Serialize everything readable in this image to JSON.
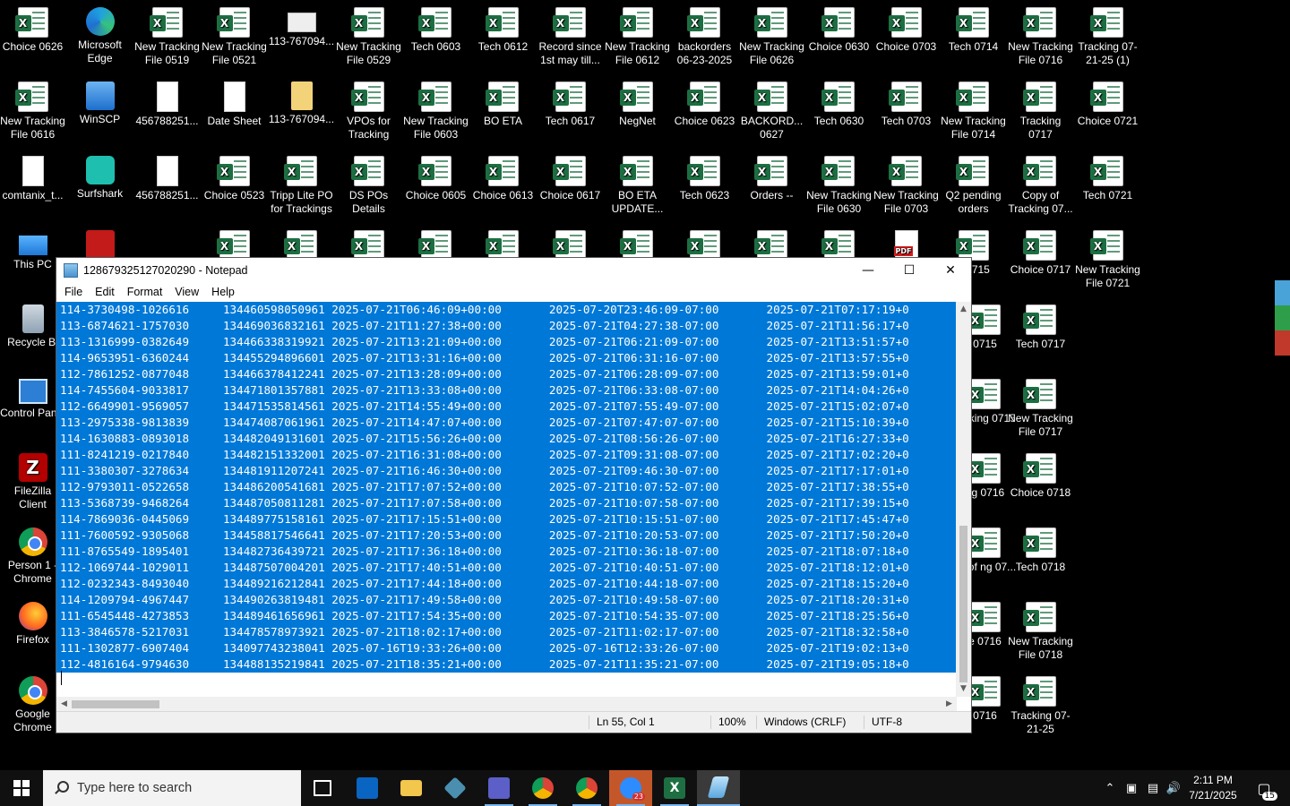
{
  "desktop": {
    "row1": [
      {
        "label": "Choice 0626",
        "icon": "excel-icon"
      },
      {
        "label": "Microsoft Edge",
        "icon": "edge-icon"
      },
      {
        "label": "New Tracking File 0519",
        "icon": "excel-icon"
      },
      {
        "label": "New Tracking File 0521",
        "icon": "excel-icon"
      },
      {
        "label": "113-767094...",
        "icon": "image-icon"
      },
      {
        "label": "New Tracking File 0529",
        "icon": "excel-icon"
      },
      {
        "label": "Tech 0603",
        "icon": "excel-icon"
      },
      {
        "label": "Tech 0612",
        "icon": "excel-icon"
      },
      {
        "label": "Record since 1st may till...",
        "icon": "excel-icon"
      },
      {
        "label": "New Tracking File 0612",
        "icon": "excel-icon"
      },
      {
        "label": "backorders 06-23-2025",
        "icon": "excel-icon"
      },
      {
        "label": "New Tracking File 0626",
        "icon": "excel-icon"
      },
      {
        "label": "Choice 0630",
        "icon": "excel-icon"
      },
      {
        "label": "Choice 0703",
        "icon": "excel-icon"
      },
      {
        "label": "Tech 0714",
        "icon": "excel-icon"
      },
      {
        "label": "New Tracking File 0716",
        "icon": "excel-icon"
      },
      {
        "label": "Tracking 07-21-25 (1)",
        "icon": "excel-icon"
      }
    ],
    "row2": [
      {
        "label": "New Tracking File 0616",
        "icon": "excel-icon"
      },
      {
        "label": "WinSCP",
        "icon": "winscp-icon"
      },
      {
        "label": "456788251...",
        "icon": "document-icon"
      },
      {
        "label": "Date Sheet",
        "icon": "document-icon"
      },
      {
        "label": "113-767094...",
        "icon": "folder-icon"
      },
      {
        "label": "VPOs for Tracking",
        "icon": "excel-icon"
      },
      {
        "label": "New Tracking File 0603",
        "icon": "excel-icon"
      },
      {
        "label": "BO ETA",
        "icon": "excel-icon"
      },
      {
        "label": "Tech 0617",
        "icon": "excel-icon"
      },
      {
        "label": "NegNet",
        "icon": "excel-icon"
      },
      {
        "label": "Choice 0623",
        "icon": "excel-icon"
      },
      {
        "label": "BACKORD... 0627",
        "icon": "excel-icon"
      },
      {
        "label": "Tech 0630",
        "icon": "excel-icon"
      },
      {
        "label": "Tech 0703",
        "icon": "excel-icon"
      },
      {
        "label": "New Tracking File 0714",
        "icon": "excel-icon"
      },
      {
        "label": "Tracking 0717",
        "icon": "excel-icon"
      },
      {
        "label": "Choice 0721",
        "icon": "excel-icon"
      }
    ],
    "row3": [
      {
        "label": "comtanix_t...",
        "icon": "document-icon"
      },
      {
        "label": "Surfshark",
        "icon": "surfshark-icon"
      },
      {
        "label": "456788251...",
        "icon": "document-icon"
      },
      {
        "label": "Choice 0523",
        "icon": "excel-icon"
      },
      {
        "label": "Tripp Lite PO for Trackings",
        "icon": "excel-icon"
      },
      {
        "label": "DS POs Details",
        "icon": "excel-icon"
      },
      {
        "label": "Choice 0605",
        "icon": "excel-icon"
      },
      {
        "label": "Choice 0613",
        "icon": "excel-icon"
      },
      {
        "label": "Choice 0617",
        "icon": "excel-icon"
      },
      {
        "label": "BO ETA UPDATE...",
        "icon": "excel-icon"
      },
      {
        "label": "Tech 0623",
        "icon": "excel-icon"
      },
      {
        "label": "Orders --",
        "icon": "excel-icon"
      },
      {
        "label": "New Tracking File 0630",
        "icon": "excel-icon"
      },
      {
        "label": "New Tracking File 0703",
        "icon": "excel-icon"
      },
      {
        "label": "Q2 pending orders",
        "icon": "excel-icon"
      },
      {
        "label": "Copy of Tracking 07...",
        "icon": "excel-icon"
      },
      {
        "label": "Tech 0721",
        "icon": "excel-icon"
      }
    ],
    "row4_right": [
      {
        "label": "e 0715",
        "icon": "excel-icon"
      },
      {
        "label": "Choice 0717",
        "icon": "excel-icon"
      },
      {
        "label": "New Tracking File 0721",
        "icon": "excel-icon"
      }
    ],
    "left_column": [
      {
        "label": "This PC",
        "icon": "this-pc-icon"
      },
      {
        "label": "Recycle Bi",
        "icon": "recycle-bin-icon"
      },
      {
        "label": "Control Panel",
        "icon": "control-panel-icon"
      },
      {
        "label": "FileZilla Client",
        "icon": "filezilla-icon"
      },
      {
        "label": "Person 1 - Chrome",
        "icon": "chrome-icon"
      },
      {
        "label": "Firefox",
        "icon": "firefox-icon"
      },
      {
        "label": "Google Chrome",
        "icon": "chrome-icon"
      }
    ],
    "right_col_a": [
      {
        "label": "0715",
        "icon": "excel-icon"
      },
      {
        "label": "racking 0715",
        "icon": "excel-icon"
      },
      {
        "label": "ng 0716",
        "icon": "excel-icon"
      },
      {
        "label": "py of ng 07...",
        "icon": "excel-icon"
      },
      {
        "label": "e 0716",
        "icon": "excel-icon"
      },
      {
        "label": "0716",
        "icon": "excel-icon"
      }
    ],
    "right_col_b": [
      {
        "label": "Tech 0717",
        "icon": "excel-icon"
      },
      {
        "label": "New Tracking File 0717",
        "icon": "excel-icon"
      },
      {
        "label": "Choice 0718",
        "icon": "excel-icon"
      },
      {
        "label": "Tech 0718",
        "icon": "excel-icon"
      },
      {
        "label": "New Tracking File 0718",
        "icon": "excel-icon"
      },
      {
        "label": "Tracking 07-21-25",
        "icon": "excel-icon"
      }
    ]
  },
  "notepad": {
    "title": "128679325127020290 - Notepad",
    "menu": [
      "File",
      "Edit",
      "Format",
      "View",
      "Help"
    ],
    "lines": [
      "114-3730498-1026616     134460598050961 2025-07-21T06:46:09+00:00       2025-07-20T23:46:09-07:00       2025-07-21T07:17:19+0",
      "113-6874621-1757030     134469036832161 2025-07-21T11:27:38+00:00       2025-07-21T04:27:38-07:00       2025-07-21T11:56:17+0",
      "113-1316999-0382649     134466338319921 2025-07-21T13:21:09+00:00       2025-07-21T06:21:09-07:00       2025-07-21T13:51:57+0",
      "114-9653951-6360244     134455294896601 2025-07-21T13:31:16+00:00       2025-07-21T06:31:16-07:00       2025-07-21T13:57:55+0",
      "112-7861252-0877048     134466378412241 2025-07-21T13:28:09+00:00       2025-07-21T06:28:09-07:00       2025-07-21T13:59:01+0",
      "114-7455604-9033817     134471801357881 2025-07-21T13:33:08+00:00       2025-07-21T06:33:08-07:00       2025-07-21T14:04:26+0",
      "112-6649901-9569057     134471535814561 2025-07-21T14:55:49+00:00       2025-07-21T07:55:49-07:00       2025-07-21T15:02:07+0",
      "113-2975338-9813839     134474087061961 2025-07-21T14:47:07+00:00       2025-07-21T07:47:07-07:00       2025-07-21T15:10:39+0",
      "114-1630883-0893018     134482049131601 2025-07-21T15:56:26+00:00       2025-07-21T08:56:26-07:00       2025-07-21T16:27:33+0",
      "111-8241219-0217840     134482151332001 2025-07-21T16:31:08+00:00       2025-07-21T09:31:08-07:00       2025-07-21T17:02:20+0",
      "111-3380307-3278634     134481911207241 2025-07-21T16:46:30+00:00       2025-07-21T09:46:30-07:00       2025-07-21T17:17:01+0",
      "112-9793011-0522658     134486200541681 2025-07-21T17:07:52+00:00       2025-07-21T10:07:52-07:00       2025-07-21T17:38:55+0",
      "113-5368739-9468264     134487050811281 2025-07-21T17:07:58+00:00       2025-07-21T10:07:58-07:00       2025-07-21T17:39:15+0",
      "114-7869036-0445069     134489775158161 2025-07-21T17:15:51+00:00       2025-07-21T10:15:51-07:00       2025-07-21T17:45:47+0",
      "111-7600592-9305068     134458817546641 2025-07-21T17:20:53+00:00       2025-07-21T10:20:53-07:00       2025-07-21T17:50:20+0",
      "111-8765549-1895401     134482736439721 2025-07-21T17:36:18+00:00       2025-07-21T10:36:18-07:00       2025-07-21T18:07:18+0",
      "112-1069744-1029011     134487507004201 2025-07-21T17:40:51+00:00       2025-07-21T10:40:51-07:00       2025-07-21T18:12:01+0",
      "112-0232343-8493040     134489216212841 2025-07-21T17:44:18+00:00       2025-07-21T10:44:18-07:00       2025-07-21T18:15:20+0",
      "114-1209794-4967447     134490263819481 2025-07-21T17:49:58+00:00       2025-07-21T10:49:58-07:00       2025-07-21T18:20:31+0",
      "111-6545448-4273853     134489461656961 2025-07-21T17:54:35+00:00       2025-07-21T10:54:35-07:00       2025-07-21T18:25:56+0",
      "113-3846578-5217031     134478578973921 2025-07-21T18:02:17+00:00       2025-07-21T11:02:17-07:00       2025-07-21T18:32:58+0",
      "111-1302877-6907404     134097743238041 2025-07-16T19:33:26+00:00       2025-07-16T12:33:26-07:00       2025-07-21T19:02:13+0",
      "112-4816164-9794630     134488135219841 2025-07-21T18:35:21+00:00       2025-07-21T11:35:21-07:00       2025-07-21T19:05:18+0"
    ],
    "status": {
      "position": "Ln 55, Col 1",
      "zoom": "100%",
      "line_ending": "Windows (CRLF)",
      "encoding": "UTF-8"
    }
  },
  "taskbar": {
    "search_placeholder": "Type here to search",
    "time": "2:11 PM",
    "date": "7/21/2025",
    "notification_count": "15",
    "zoom_badge": "23"
  }
}
